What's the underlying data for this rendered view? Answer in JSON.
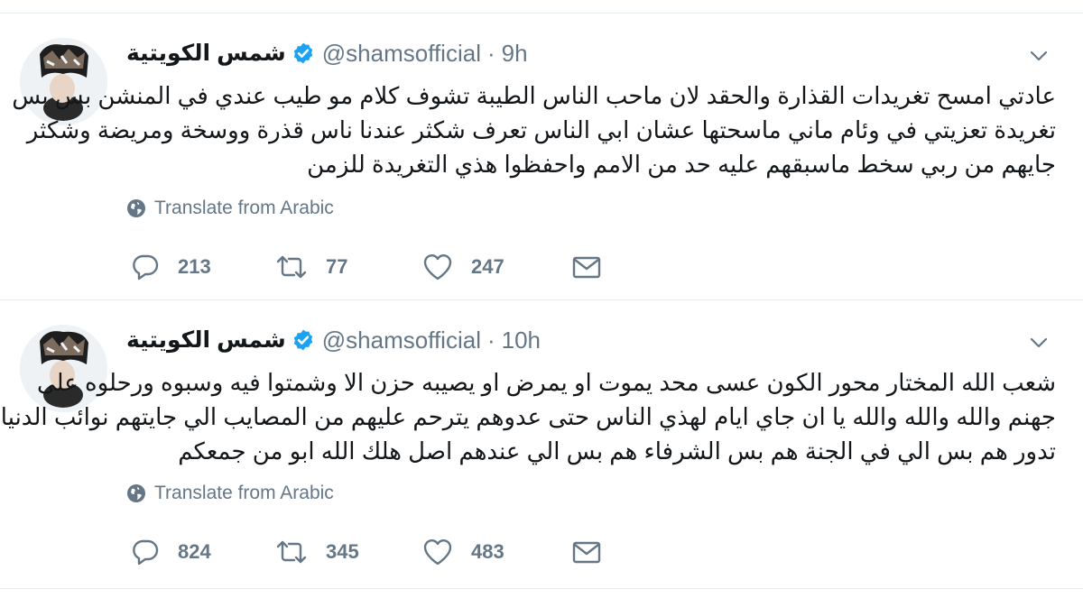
{
  "tweets": [
    {
      "display_name": "شمس الكويتية",
      "handle": "@shamsofficial",
      "separator": "·",
      "time": "9h",
      "text_lines": [
        "عادتي امسح تغريدات القذارة والحقد لان ماحب الناس الطيبة تشوف كلام مو طيب عندي في المنشن بس بس",
        "تغريدة تعزيتي في وئام ماني ماسحتها عشان ابي الناس تعرف شكثر عندنا ناس قذرة ووسخة ومريضة وشكثر",
        "جايهم من ربي سخط ماسبقهم عليه حد من الامم واحفظوا هذي التغريدة للزمن"
      ],
      "translate_label": "Translate from Arabic",
      "replies": "213",
      "retweets": "77",
      "likes": "247"
    },
    {
      "display_name": "شمس الكويتية",
      "handle": "@shamsofficial",
      "separator": "·",
      "time": "10h",
      "text_lines": [
        "شعب الله المختار محور الكون عسى محد يموت او يمرض او يصيبه حزن الا وشمتوا فيه وسبوه ورحلوه على",
        "جهنم والله والله والله يا ان جاي ايام لهذي الناس حتى عدوهم يترحم عليهم من المصايب الي جايتهم  نوائب الدنيا",
        "تدور هم بس الي في الجنة هم بس الشرفاء هم بس الي عندهم اصل هلك الله ابو من جمعكم"
      ],
      "translate_label": "Translate from Arabic",
      "replies": "824",
      "retweets": "345",
      "likes": "483"
    }
  ],
  "colors": {
    "text": "#14171a",
    "secondary": "#657786",
    "verified": "#1da1f2",
    "divider": "#e6ecf0"
  },
  "icons": {
    "verified": "verified-badge-icon",
    "caret": "chevron-down-icon",
    "globe": "globe-icon",
    "reply": "reply-icon",
    "retweet": "retweet-icon",
    "like": "heart-icon",
    "dm": "envelope-icon"
  }
}
